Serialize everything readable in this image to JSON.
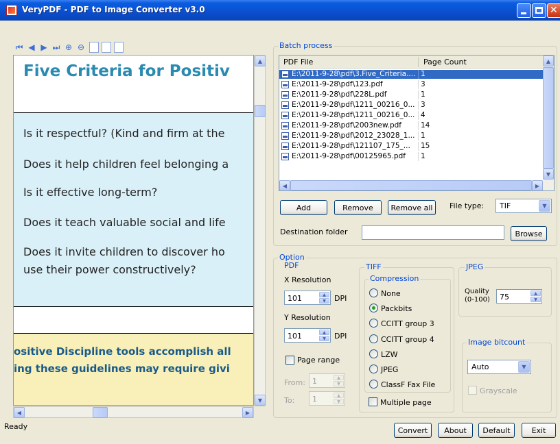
{
  "window": {
    "title": "VeryPDF - PDF to Image Converter v3.0"
  },
  "toolbar": {
    "icons": [
      "first-page",
      "previous-page",
      "next-page",
      "last-page",
      "zoom-in",
      "zoom-out",
      "single-page",
      "two-page",
      "continuous-page"
    ],
    "glyphs": [
      "⏮",
      "◀",
      "▶",
      "⏭",
      "⊕",
      "⊖",
      "",
      "",
      ""
    ]
  },
  "preview": {
    "title": "Five Criteria for Positiv",
    "lines": [
      "Is it respectful? (Kind and firm at the",
      "Does it help children feel belonging a",
      "Is it effective long-term?",
      "Does it teach valuable social and life",
      "Does it invite children to discover ho",
      "use their power constructively?"
    ],
    "footer_lines": [
      "ositive Discipline tools accomplish all",
      "ing these guidelines may require givi"
    ]
  },
  "status": "Ready",
  "batch": {
    "legend": "Batch process",
    "col_file": "PDF File",
    "col_pages": "Page Count",
    "rows": [
      {
        "file": "E:\\2011-9-28\\pdf\\3.Five_Criteria....",
        "pages": "1",
        "selected": true
      },
      {
        "file": "E:\\2011-9-28\\pdf\\123.pdf",
        "pages": "3",
        "selected": false
      },
      {
        "file": "E:\\2011-9-28\\pdf\\228L.pdf",
        "pages": "1",
        "selected": false
      },
      {
        "file": "E:\\2011-9-28\\pdf\\1211_00216_0...",
        "pages": "3",
        "selected": false
      },
      {
        "file": "E:\\2011-9-28\\pdf\\1211_00216_0...",
        "pages": "4",
        "selected": false
      },
      {
        "file": "E:\\2011-9-28\\pdf\\2003new.pdf",
        "pages": "14",
        "selected": false
      },
      {
        "file": "E:\\2011-9-28\\pdf\\2012_23028_1...",
        "pages": "1",
        "selected": false
      },
      {
        "file": "E:\\2011-9-28\\pdf\\121107_175_...",
        "pages": "15",
        "selected": false
      },
      {
        "file": "E:\\2011-9-28\\pdf\\00125965.pdf",
        "pages": "1",
        "selected": false
      }
    ],
    "add": "Add",
    "remove": "Remove",
    "remove_all": "Remove all",
    "file_type_label": "File type:",
    "file_type": "TIF",
    "dest_label": "Destination folder",
    "dest_value": "",
    "browse": "Browse"
  },
  "option": {
    "legend": "Option",
    "pdf": {
      "legend": "PDF",
      "xres_label": "X Resolution",
      "xres": "101",
      "yres_label": "Y Resolution",
      "yres": "101",
      "dpi": "DPI",
      "page_range": "Page range",
      "from_label": "From:",
      "from": "1",
      "to_label": "To:",
      "to": "1"
    },
    "tiff": {
      "legend": "TIFF",
      "compression_legend": "Compression",
      "options": [
        "None",
        "Packbits",
        "CCITT group 3",
        "CCITT group 4",
        "LZW",
        "JPEG",
        "ClassF Fax File"
      ],
      "selected": "Packbits",
      "multiple_page": "Multiple page"
    },
    "jpeg": {
      "legend": "JPEG",
      "quality_label_1": "Quality",
      "quality_label_2": "(0-100)",
      "quality": "75",
      "bitcount_legend": "Image bitcount",
      "bitcount": "Auto",
      "grayscale": "Grayscale"
    }
  },
  "actions": {
    "convert": "Convert",
    "about": "About",
    "default": "Default",
    "exit": "Exit"
  }
}
